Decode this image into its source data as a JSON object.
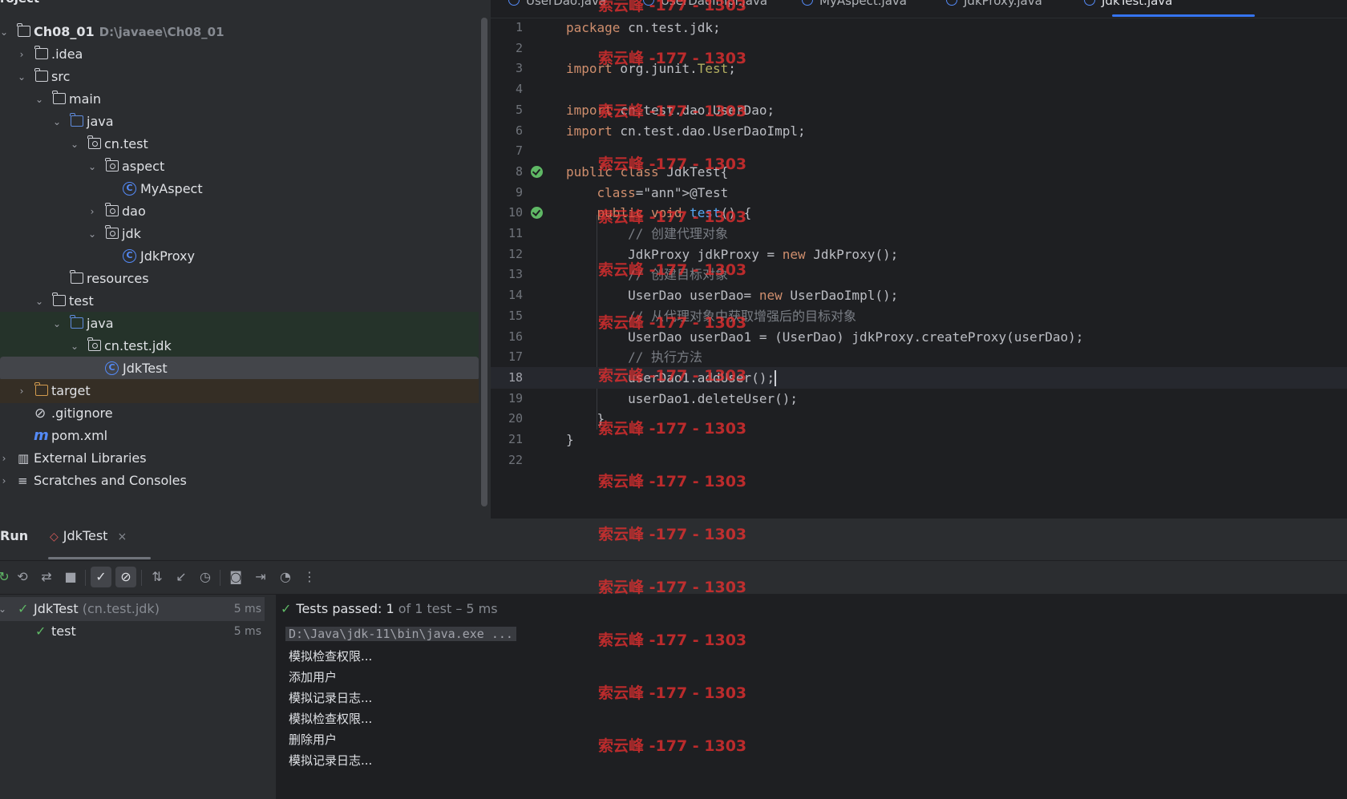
{
  "project": {
    "title": "roject",
    "tree": [
      {
        "label": "Ch08_01",
        "path": "D:\\javaee\\Ch08_01"
      },
      {
        "label": ".idea"
      },
      {
        "label": "src"
      },
      {
        "label": "main"
      },
      {
        "label": "java"
      },
      {
        "label": "cn.test"
      },
      {
        "label": "aspect"
      },
      {
        "label": "MyAspect"
      },
      {
        "label": "dao"
      },
      {
        "label": "jdk"
      },
      {
        "label": "JdkProxy"
      },
      {
        "label": "resources"
      },
      {
        "label": "test"
      },
      {
        "label": "java"
      },
      {
        "label": "cn.test.jdk"
      },
      {
        "label": "JdkTest"
      },
      {
        "label": "target"
      },
      {
        "label": ".gitignore"
      },
      {
        "label": "pom.xml"
      },
      {
        "label": "External Libraries"
      },
      {
        "label": "Scratches and Consoles"
      }
    ]
  },
  "editor": {
    "tabs": [
      "UserDao.java",
      "UserDaoImpl.java",
      "MyAspect.java",
      "JdkProxy.java",
      "JdkTest.java"
    ],
    "active_tab": "JdkTest.java",
    "current_line": 18,
    "lines": [
      {
        "n": "1",
        "t": "package cn.test.jdk;"
      },
      {
        "n": "2",
        "t": ""
      },
      {
        "n": "3",
        "t": "import org.junit.Test;"
      },
      {
        "n": "4",
        "t": ""
      },
      {
        "n": "5",
        "t": "import cn.test.dao.UserDao;"
      },
      {
        "n": "6",
        "t": "import cn.test.dao.UserDaoImpl;"
      },
      {
        "n": "7",
        "t": ""
      },
      {
        "n": "8",
        "t": "public class JdkTest{"
      },
      {
        "n": "9",
        "t": "    @Test"
      },
      {
        "n": "10",
        "t": "    public void test() {"
      },
      {
        "n": "11",
        "t": "        // 创建代理对象"
      },
      {
        "n": "12",
        "t": "        JdkProxy jdkProxy = new JdkProxy();"
      },
      {
        "n": "13",
        "t": "        // 创建目标对象"
      },
      {
        "n": "14",
        "t": "        UserDao userDao= new UserDaoImpl();"
      },
      {
        "n": "15",
        "t": "        // 从代理对象中获取增强后的目标对象"
      },
      {
        "n": "16",
        "t": "        UserDao userDao1 = (UserDao) jdkProxy.createProxy(userDao);"
      },
      {
        "n": "17",
        "t": "        // 执行方法"
      },
      {
        "n": "18",
        "t": "        userDao1.addUser();"
      },
      {
        "n": "19",
        "t": "        userDao1.deleteUser();"
      },
      {
        "n": "20",
        "t": "    }"
      },
      {
        "n": "21",
        "t": "}"
      },
      {
        "n": "22",
        "t": ""
      }
    ]
  },
  "run": {
    "title": "Run",
    "tab_label": "JdkTest",
    "tab_close": "×",
    "tests": [
      {
        "name": "JdkTest",
        "pkg": "(cn.test.jdk)",
        "duration": "5 ms"
      },
      {
        "name": "test",
        "pkg": "",
        "duration": "5 ms"
      }
    ],
    "summary": {
      "prefix": "Tests passed: ",
      "passed": "1",
      "rest": " of 1 test – 5 ms"
    },
    "output": [
      "D:\\Java\\jdk-11\\bin\\java.exe ...",
      "模拟检查权限...",
      "添加用户",
      "模拟记录日志...",
      "模拟检查权限...",
      "删除用户",
      "模拟记录日志..."
    ]
  },
  "watermark": "索云峰 -177 - 1303",
  "colors": {
    "accent": "#3574f0",
    "pass": "#5fb865",
    "watermark": "#e83030"
  }
}
